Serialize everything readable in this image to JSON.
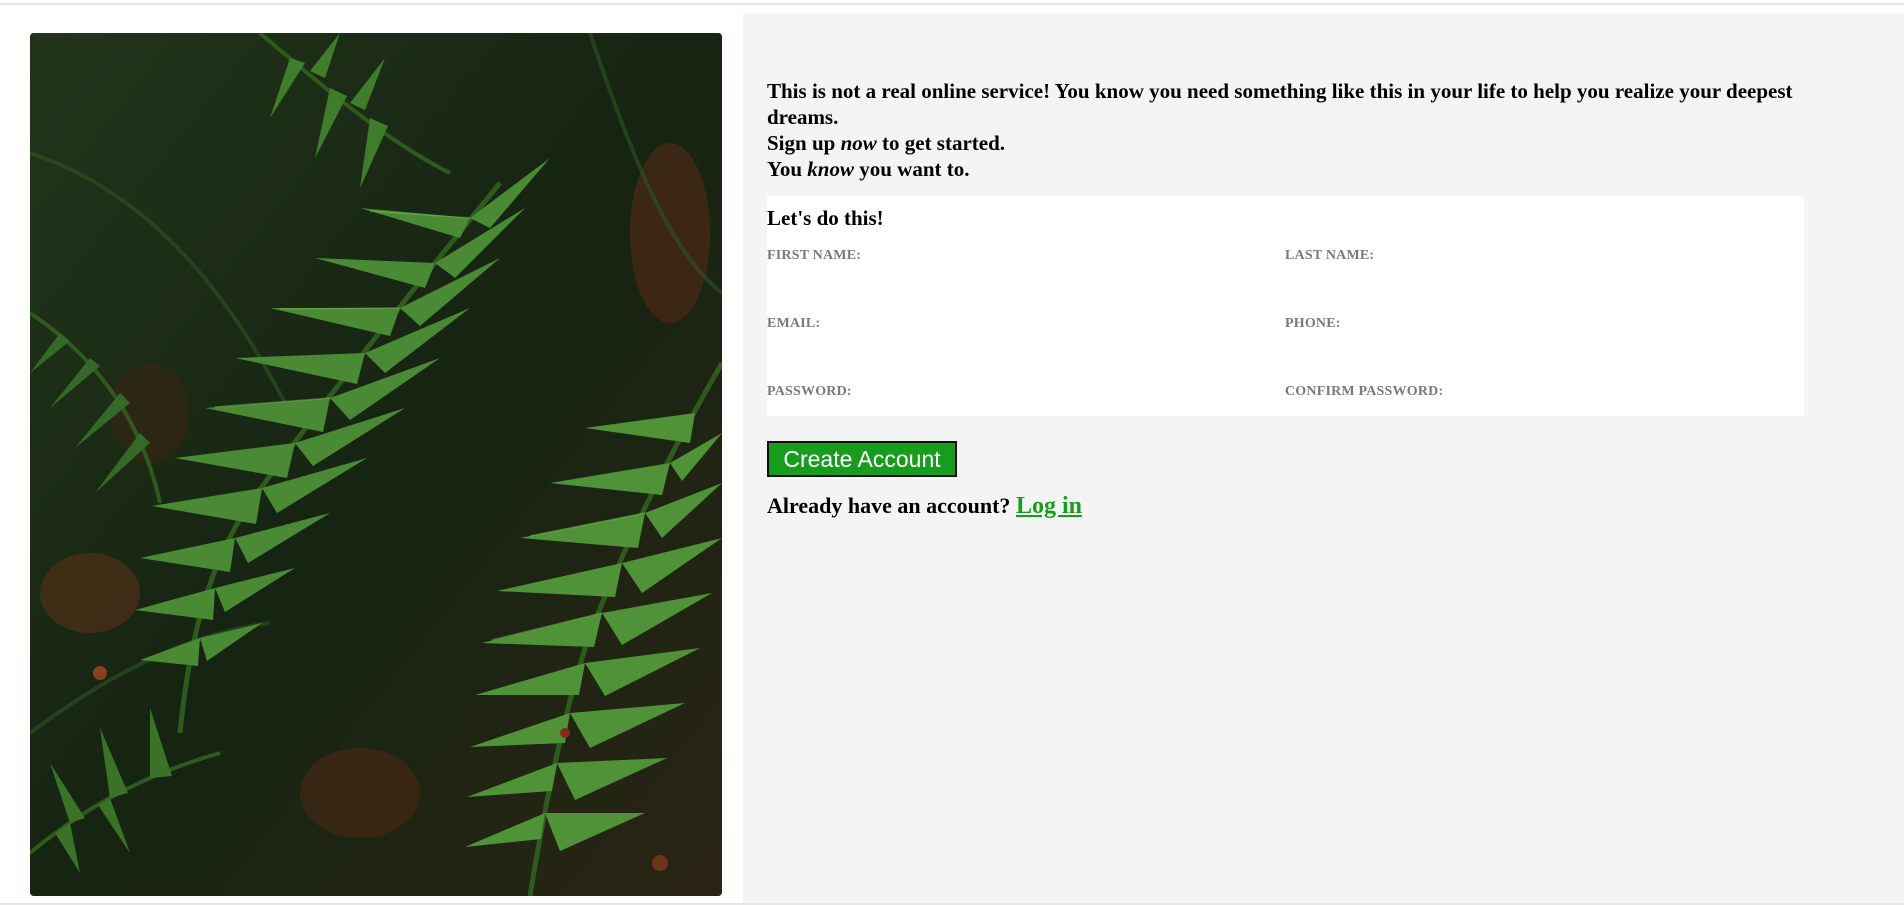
{
  "hero": {
    "image": "fern-leaves-photo",
    "colors": {
      "dark": "#1d2a16",
      "fern": "#3f7d2c",
      "fern_light": "#5a9a3c",
      "bark": "#6b3a1e"
    }
  },
  "intro": {
    "line1": "This is not a real online service! You know you need something like this in your life to help you realize your deepest dreams.",
    "line2_a": "Sign up ",
    "line2_em": "now",
    "line2_b": " to get started.",
    "line3_a": "You ",
    "line3_em": "know",
    "line3_b": " you want to."
  },
  "form": {
    "title": "Let's do this!",
    "fields": [
      {
        "label": "FIRST NAME:",
        "value": ""
      },
      {
        "label": "LAST NAME:",
        "value": ""
      },
      {
        "label": "EMAIL:",
        "value": ""
      },
      {
        "label": "PHONE:",
        "value": ""
      },
      {
        "label": "PASSWORD:",
        "value": ""
      },
      {
        "label": "CONFIRM PASSWORD:",
        "value": ""
      }
    ]
  },
  "actions": {
    "create_label": "Create Account",
    "login_prompt": "Already have an account? ",
    "login_link": "Log in"
  },
  "colors": {
    "accent": "#179c1d",
    "panel_bg": "#f4f4f4",
    "label": "#7a7a7a"
  }
}
